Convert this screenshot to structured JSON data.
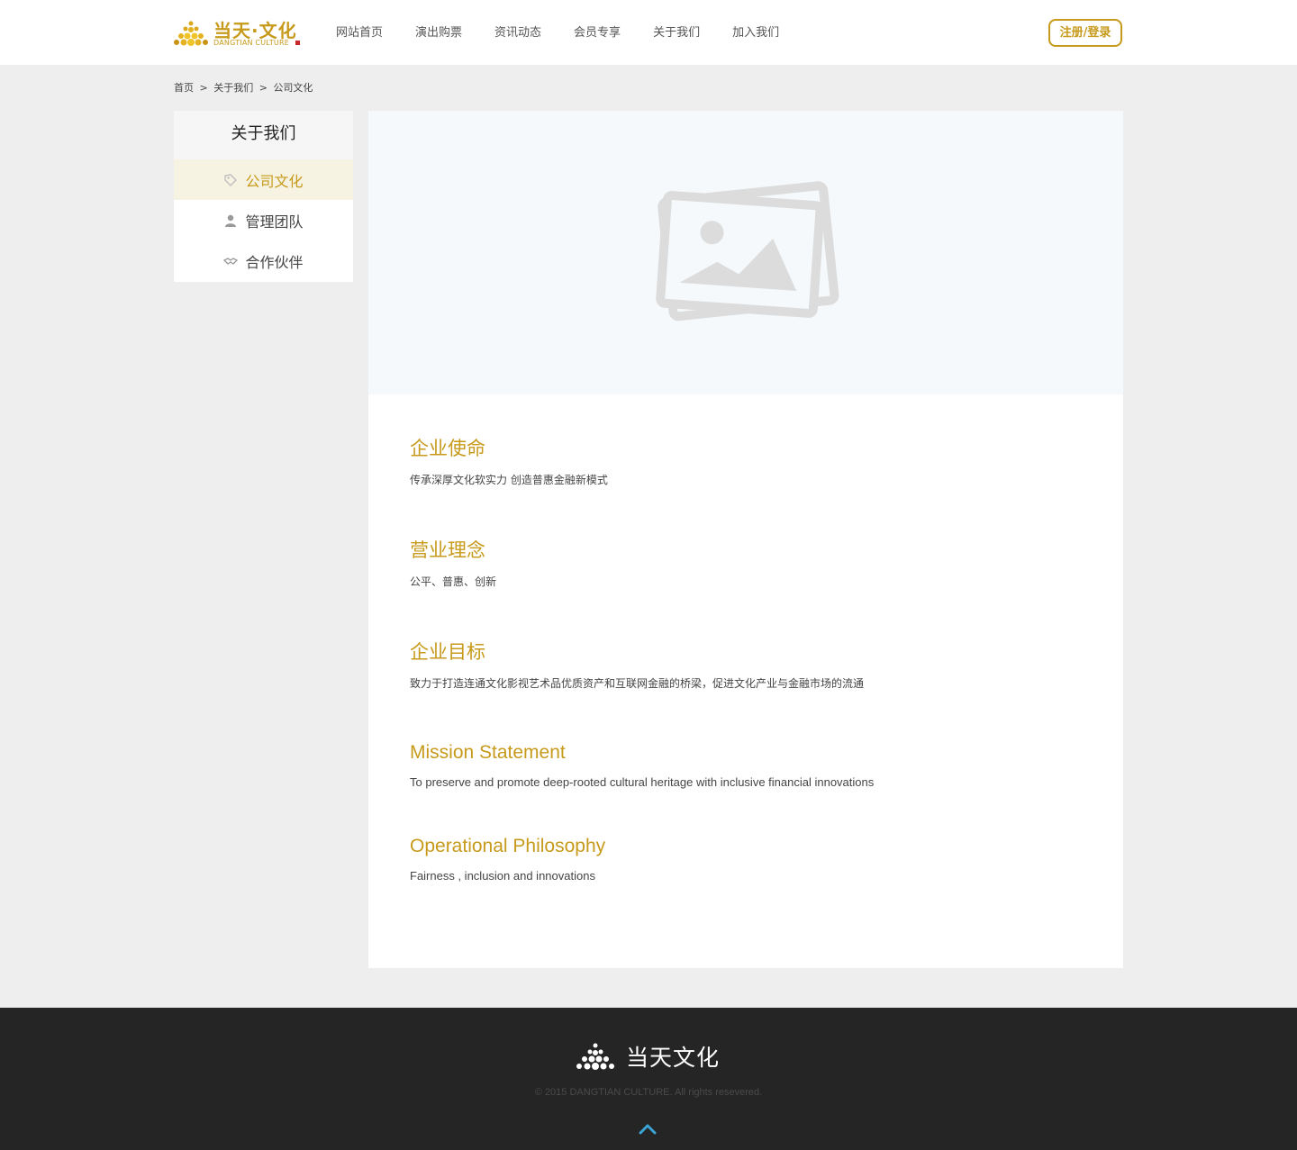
{
  "header": {
    "logo_cn": "当天·文化",
    "logo_en": "DANGTIAN CULTURE",
    "nav": [
      "网站首页",
      "演出购票",
      "资讯动态",
      "会员专享",
      "关于我们",
      "加入我们"
    ],
    "login_label": "注册/登录"
  },
  "breadcrumb": {
    "items": [
      "首页",
      "关于我们",
      "公司文化"
    ],
    "separator": ">"
  },
  "sidebar": {
    "title": "关于我们",
    "items": [
      {
        "label": "公司文化",
        "icon": "tag-icon",
        "active": true
      },
      {
        "label": "管理团队",
        "icon": "person-icon",
        "active": false
      },
      {
        "label": "合作伙伴",
        "icon": "handshake-icon",
        "active": false
      }
    ]
  },
  "main": {
    "banner_icon": "image-placeholder-icon",
    "sections": [
      {
        "title": "企业使命",
        "text": "传承深厚文化软实力 创造普惠金融新模式"
      },
      {
        "title": "营业理念",
        "text": "公平、普惠、创新"
      },
      {
        "title": "企业目标",
        "text": "致力于打造连通文化影视艺术品优质资产和互联网金融的桥梁，促进文化产业与金融市场的流通"
      },
      {
        "title": "Mission Statement",
        "text": "To preserve and promote deep-rooted cultural heritage with inclusive financial innovations"
      },
      {
        "title": "Operational Philosophy",
        "text": "Fairness , inclusion and innovations"
      }
    ]
  },
  "footer": {
    "name": "当天文化",
    "copyright": "© 2015 DANGTIAN CULTURE. All rights resevered."
  },
  "colors": {
    "accent": "#c79a1b",
    "footer_bg": "#252525",
    "page_bg": "#eeeeee",
    "up_arrow": "#3ba6d6"
  }
}
